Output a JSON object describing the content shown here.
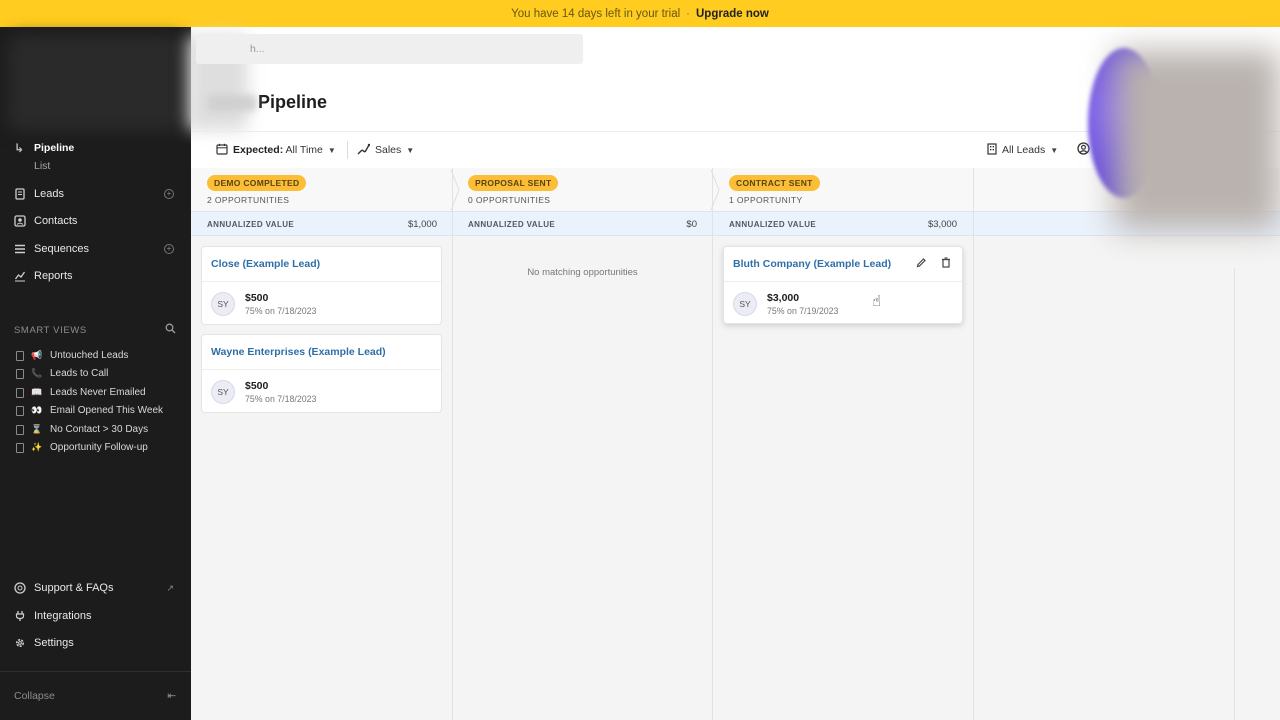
{
  "banner": {
    "message": "You have 14 days left in your trial",
    "separator": "·",
    "upgrade_label": "Upgrade now"
  },
  "search": {
    "placeholder": "h..."
  },
  "page": {
    "title": "Pipeline"
  },
  "sidebar": {
    "pipeline_label": "Pipeline",
    "list_label": "List",
    "items": [
      {
        "label": "Leads",
        "icon": "file-icon"
      },
      {
        "label": "Contacts",
        "icon": "contacts-icon"
      },
      {
        "label": "Sequences",
        "icon": "list-icon"
      },
      {
        "label": "Reports",
        "icon": "chart-icon"
      }
    ],
    "smart_views_title": "SMART VIEWS",
    "smart_views": [
      {
        "emoji": "📢",
        "label": "Untouched Leads"
      },
      {
        "emoji": "📞",
        "label": "Leads to Call"
      },
      {
        "emoji": "📖",
        "label": "Leads Never Emailed"
      },
      {
        "emoji": "👀",
        "label": "Email Opened This Week"
      },
      {
        "emoji": "⌛",
        "label": "No Contact > 30 Days"
      },
      {
        "emoji": "✨",
        "label": "Opportunity Follow-up"
      }
    ],
    "bottom": [
      {
        "label": "Support & FAQs",
        "icon": "help-icon"
      },
      {
        "label": "Integrations",
        "icon": "plug-icon"
      },
      {
        "label": "Settings",
        "icon": "gear-icon"
      }
    ],
    "collapse_label": "Collapse"
  },
  "toolbar": {
    "expected_key": "Expected",
    "expected_value": "All Time",
    "pipeline_value": "Sales",
    "leads_filter": "All Leads"
  },
  "columns": [
    {
      "stage": "DEMO COMPLETED",
      "count": "2 OPPORTUNITIES",
      "value_label": "ANNUALIZED VALUE",
      "value": "$1,000",
      "cards": [
        {
          "name": "Close (Example Lead)",
          "initials": "SY",
          "amount": "$500",
          "detail": "75% on 7/18/2023"
        },
        {
          "name": "Wayne Enterprises (Example Lead)",
          "initials": "SY",
          "amount": "$500",
          "detail": "75% on 7/18/2023"
        }
      ]
    },
    {
      "stage": "PROPOSAL SENT",
      "count": "0 OPPORTUNITIES",
      "value_label": "ANNUALIZED VALUE",
      "value": "$0",
      "empty_text": "No matching opportunities",
      "cards": []
    },
    {
      "stage": "CONTRACT SENT",
      "count": "1 OPPORTUNITY",
      "value_label": "ANNUALIZED VALUE",
      "value": "$3,000",
      "cards": [
        {
          "name": "Bluth Company (Example Lead)",
          "initials": "SY",
          "amount": "$3,000",
          "detail": "75% on 7/19/2023"
        }
      ]
    }
  ],
  "colors": {
    "banner": "#ffcc1f",
    "sidebar": "#1c1c1c",
    "stage_badge": "#fbbe36",
    "link": "#2f6fa8"
  }
}
